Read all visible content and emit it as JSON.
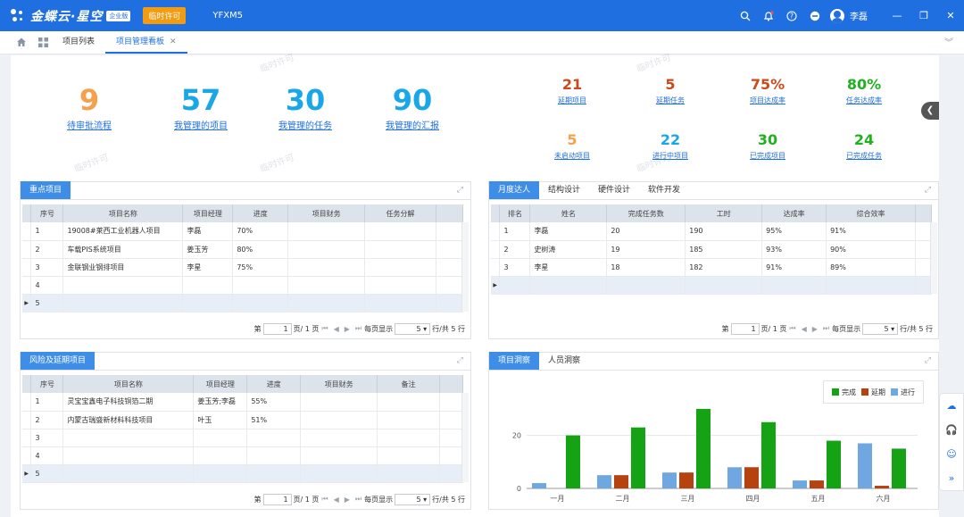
{
  "app": {
    "brand": "金蝶云·星空",
    "edition": "企业版",
    "license_badge": "临时许可",
    "tenant": "YFXM5",
    "user": "李磊"
  },
  "tabs": [
    {
      "label": "项目列表",
      "active": false
    },
    {
      "label": "项目管理看板",
      "active": true
    }
  ],
  "big_stats": [
    {
      "value": "9",
      "label": "待审批流程",
      "color": "#f5a04b"
    },
    {
      "value": "57",
      "label": "我管理的项目",
      "color": "#1aa7e8"
    },
    {
      "value": "30",
      "label": "我管理的任务",
      "color": "#1aa7e8"
    },
    {
      "value": "90",
      "label": "我管理的汇报",
      "color": "#1aa7e8"
    }
  ],
  "small_stats": [
    {
      "value": "21",
      "label": "延期项目",
      "color": "#c94a1c"
    },
    {
      "value": "5",
      "label": "延期任务",
      "color": "#c94a1c"
    },
    {
      "value": "75%",
      "label": "项目达成率",
      "color": "#c94a1c"
    },
    {
      "value": "80%",
      "label": "任务达成率",
      "color": "#22b022"
    },
    {
      "value": "5",
      "label": "未启动项目",
      "color": "#f5a04b"
    },
    {
      "value": "22",
      "label": "进行中项目",
      "color": "#1aa7e8"
    },
    {
      "value": "30",
      "label": "已完成项目",
      "color": "#22b022"
    },
    {
      "value": "24",
      "label": "已完成任务",
      "color": "#22b022"
    }
  ],
  "key_projects": {
    "tab": "重点项目",
    "columns": [
      "序号",
      "项目名称",
      "项目经理",
      "进度",
      "项目财务",
      "任务分解"
    ],
    "rows": [
      [
        "1",
        "19008#莱西工业机器人项目",
        "李磊",
        "70%",
        "",
        ""
      ],
      [
        "2",
        "车载PIS系统项目",
        "姜玉芳",
        "80%",
        "",
        ""
      ],
      [
        "3",
        "金联钢业钢排项目",
        "李星",
        "75%",
        "",
        ""
      ],
      [
        "4",
        "",
        "",
        "",
        "",
        ""
      ],
      [
        "5",
        "",
        "",
        "",
        "",
        ""
      ]
    ],
    "pager": {
      "page_prefix": "第",
      "page_value": "1",
      "page_suffix": "页/ 1 页",
      "per_page_label": "每页显示",
      "per_page_value": "5",
      "total": "行/共 5 行"
    }
  },
  "monthly_stars": {
    "tabs": [
      "月度达人",
      "结构设计",
      "硬件设计",
      "软件开发"
    ],
    "columns": [
      "排名",
      "姓名",
      "完成任务数",
      "工时",
      "达成率",
      "综合效率"
    ],
    "rows": [
      [
        "1",
        "李磊",
        "20",
        "190",
        "95%",
        "91%"
      ],
      [
        "2",
        "史树涛",
        "19",
        "185",
        "93%",
        "90%"
      ],
      [
        "3",
        "李星",
        "18",
        "182",
        "91%",
        "89%"
      ],
      [
        "",
        "",
        "",
        "",
        "",
        ""
      ]
    ],
    "pager": {
      "page_prefix": "第",
      "page_value": "1",
      "page_suffix": "页/ 1 页",
      "per_page_label": "每页显示",
      "per_page_value": "5",
      "total": "行/共 5 行"
    }
  },
  "risk_projects": {
    "tab": "风险及延期项目",
    "columns": [
      "序号",
      "项目名称",
      "项目经理",
      "进度",
      "项目财务",
      "备注"
    ],
    "rows": [
      [
        "1",
        "灵宝宝鑫电子科技铜箔二期",
        "姜玉芳;李磊",
        "55%",
        "",
        ""
      ],
      [
        "2",
        "内蒙古瑞盛新材料科技项目",
        "叶玉",
        "51%",
        "",
        ""
      ],
      [
        "3",
        "",
        "",
        "",
        "",
        ""
      ],
      [
        "4",
        "",
        "",
        "",
        "",
        ""
      ],
      [
        "5",
        "",
        "",
        "",
        "",
        ""
      ]
    ],
    "pager": {
      "page_prefix": "第",
      "page_value": "1",
      "page_suffix": "页/ 1 页",
      "per_page_label": "每页显示",
      "per_page_value": "5",
      "total": "行/共 5 行"
    }
  },
  "insight": {
    "tabs": [
      "项目洞察",
      "人员洞察"
    ]
  },
  "watermark_text": "临时许可",
  "chart_data": {
    "type": "bar",
    "categories": [
      "一月",
      "二月",
      "三月",
      "四月",
      "五月",
      "六月"
    ],
    "series": [
      {
        "name": "进行",
        "values": [
          2,
          5,
          6,
          8,
          3,
          17
        ],
        "color": "#6fa8e0"
      },
      {
        "name": "延期",
        "values": [
          0,
          5,
          6,
          8,
          3,
          1
        ],
        "color": "#b5420f"
      },
      {
        "name": "完成",
        "values": [
          20,
          23,
          30,
          25,
          18,
          15
        ],
        "color": "#15a215"
      }
    ],
    "legend_order": [
      "完成",
      "延期",
      "进行"
    ],
    "yticks": [
      "0",
      "20"
    ],
    "ylim": [
      0,
      33
    ],
    "legend_position": "top-right",
    "grid": true
  }
}
